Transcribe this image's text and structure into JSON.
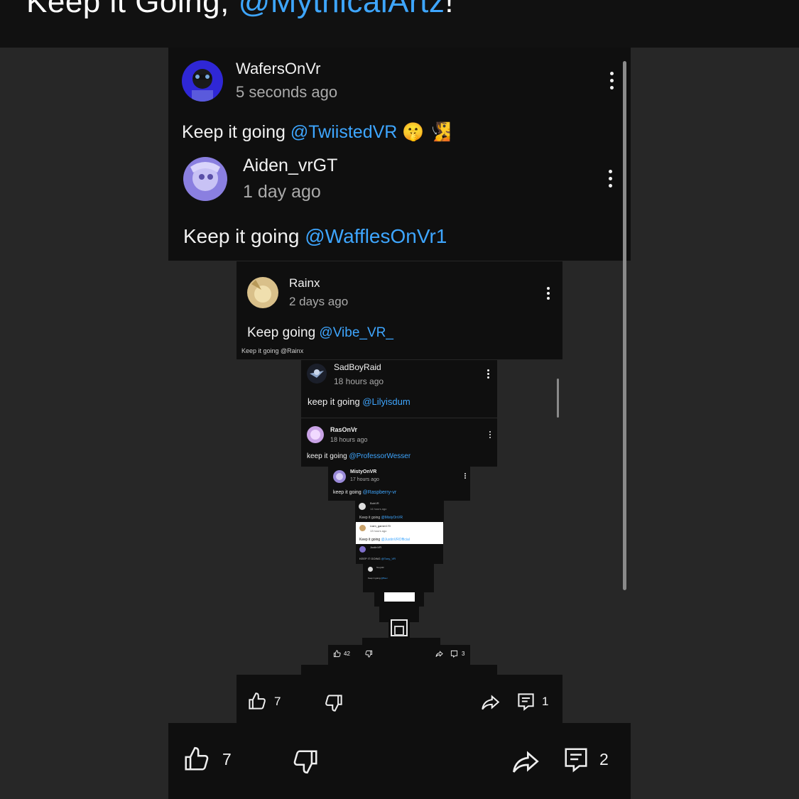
{
  "header": {
    "title_prefix": "Keep it Going, ",
    "title_mention": "@MythicalArtz",
    "title_suffix": "!"
  },
  "comments": [
    {
      "user": "WafersOnVr",
      "time": "5 seconds ago",
      "text": "Keep it going ",
      "mention": "@TwiistedVR",
      "emoji": "🤫 🧏"
    },
    {
      "user": "Aiden_vrGT",
      "time": "1 day ago",
      "text": "Keep it going ",
      "mention": "@WafflesOnVr1"
    },
    {
      "user": "Rainx",
      "time": "2 days ago",
      "text": "Keep going ",
      "mention": "@Vibe_VR_",
      "cut_text": "Keep it going @Rainx"
    },
    {
      "user": "SadBoyRaid",
      "time": "18 hours ago",
      "text": "keep it going ",
      "mention": "@Lilyisdum"
    },
    {
      "user": "RasOnVr",
      "time": "18 hours ago",
      "text": "keep it going ",
      "mention": "@ProfessorWesser"
    },
    {
      "user": "MistyOnVR",
      "time": "17 hours ago",
      "text": "keep it going ",
      "mention": "@Raspberry-vr"
    },
    {
      "user": "BobVR",
      "time": "14 hours ago",
      "text": "Keep it going ",
      "mention": "@MistyOnVR"
    },
    {
      "user": "Liam_gamer170",
      "time": "13 hours ago",
      "text": "Keep it going ",
      "mention": "@JustinVROfficial"
    },
    {
      "user": "JustinVR",
      "time": "1 day ago",
      "text": "KEEP IT GOING ",
      "mention": "@Tony_VR"
    },
    {
      "user": "TonyVR",
      "time": "3 hours ago",
      "text": "Keep it going ",
      "mention": "@Baer"
    }
  ],
  "action_bars": {
    "tiny": {
      "likes": "42",
      "replies": "3"
    },
    "mid": {
      "likes": "7",
      "replies": "1"
    },
    "outer": {
      "likes": "7",
      "replies": "2"
    }
  },
  "icons": [
    "thumbs-up-icon",
    "thumbs-down-icon",
    "share-icon",
    "comments-icon",
    "more-vertical-icon"
  ],
  "colors": {
    "background": "#272727",
    "panel": "#0f0f0f",
    "mention": "#3ea6ff",
    "text": "#f1f1f1",
    "secondary": "#aaaaaa"
  }
}
